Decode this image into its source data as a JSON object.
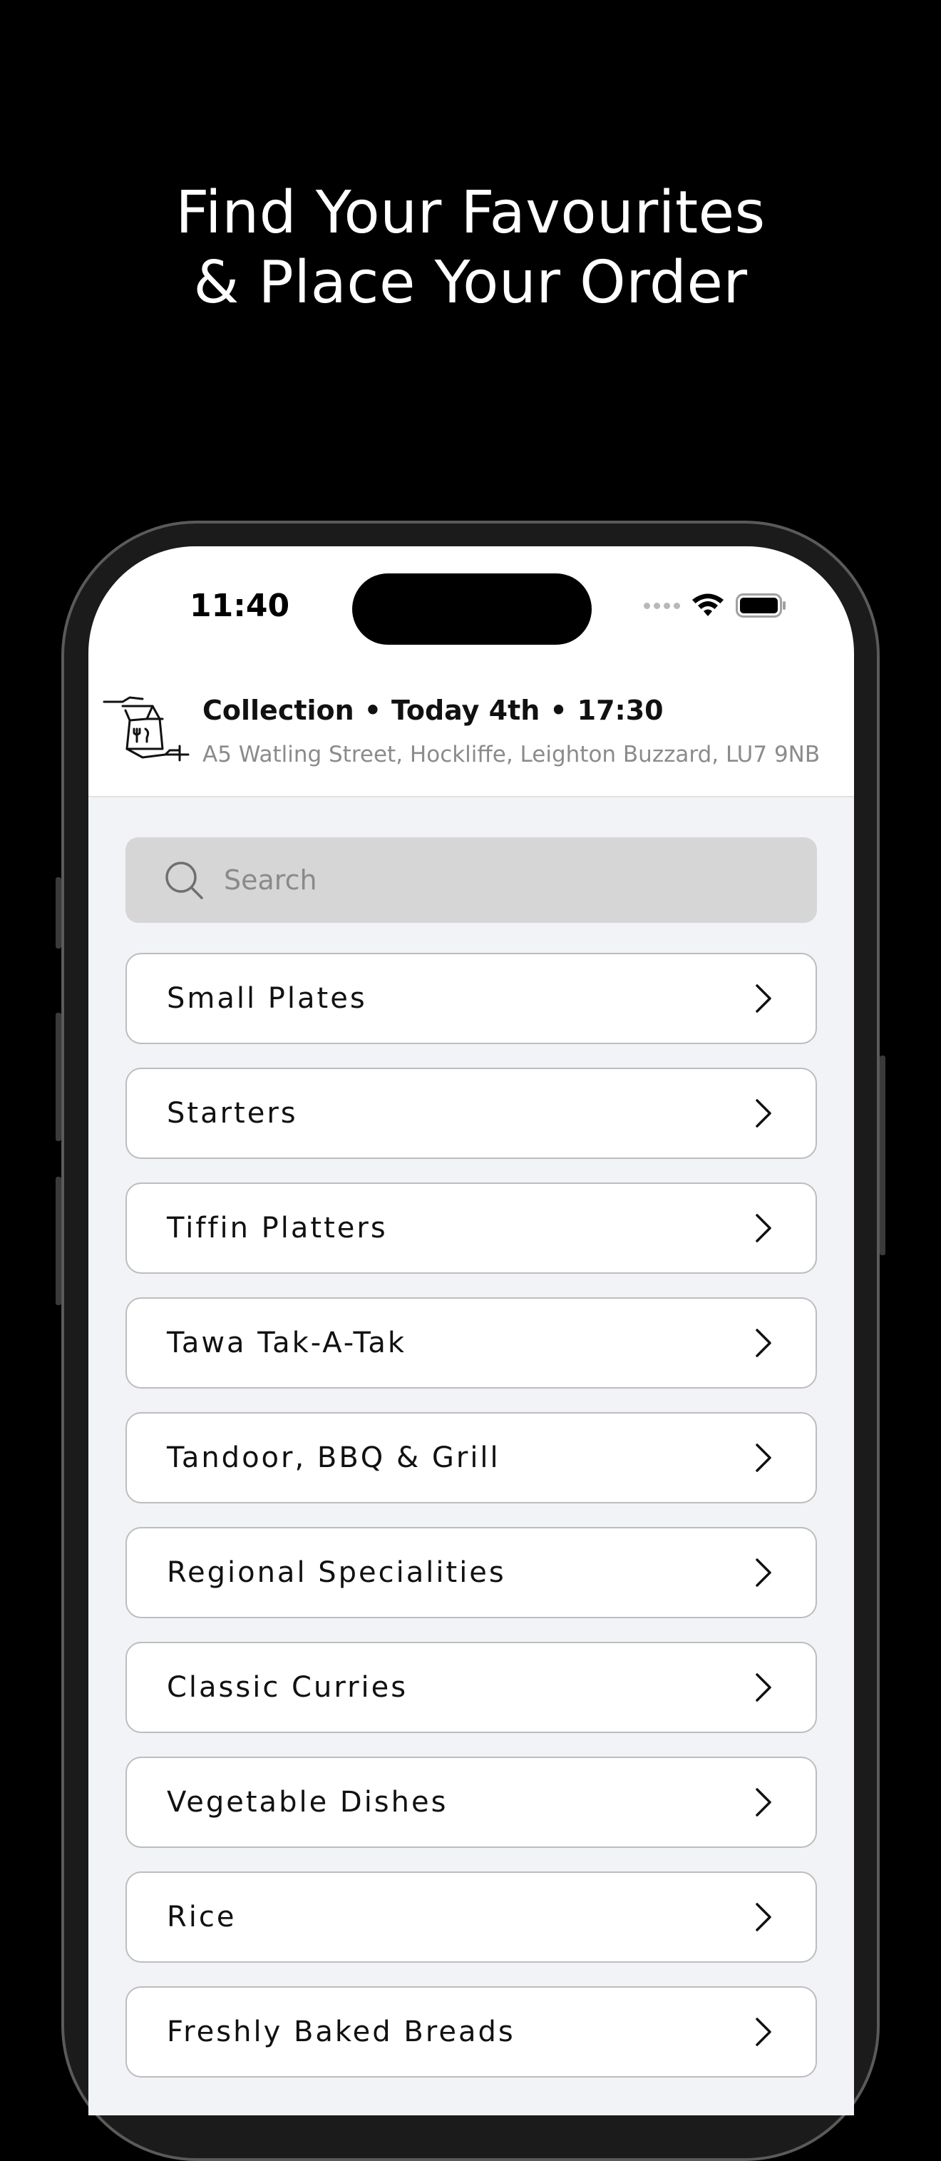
{
  "headline": {
    "line1": "Find Your Favourites",
    "line2": "& Place Your Order"
  },
  "status_bar": {
    "time": "11:40",
    "icons": [
      "cellular-signal-icon",
      "wifi-icon",
      "battery-icon"
    ]
  },
  "order_header": {
    "mode": "Collection",
    "day": "Today 4th",
    "time": "17:30",
    "separator": "•",
    "address": "A5 Watling Street, Hockliffe, Leighton Buzzard, LU7  9NB",
    "icon": "collection-bag-icon"
  },
  "search": {
    "placeholder": "Search",
    "icon": "search-icon"
  },
  "categories": [
    {
      "label": "Small Plates"
    },
    {
      "label": "Starters"
    },
    {
      "label": "Tiffin Platters"
    },
    {
      "label": "Tawa Tak-A-Tak"
    },
    {
      "label": "Tandoor, BBQ & Grill"
    },
    {
      "label": "Regional Specialities"
    },
    {
      "label": "Classic Curries"
    },
    {
      "label": "Vegetable Dishes"
    },
    {
      "label": "Rice"
    },
    {
      "label": "Freshly Baked Breads"
    }
  ],
  "colors": {
    "page_background": "#000000",
    "headline_text": "#ffffff",
    "content_background": "#f2f3f6",
    "search_background": "#d6d6d6",
    "card_border": "#bdbdbd",
    "address_text": "#8b8b8b"
  }
}
